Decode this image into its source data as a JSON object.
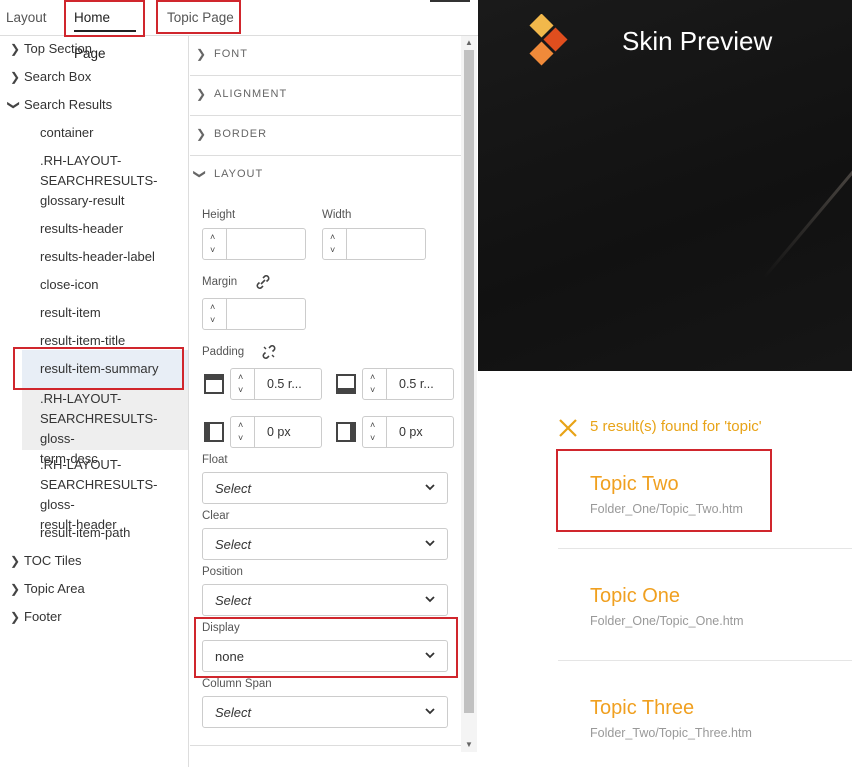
{
  "tabs": [
    "Layout",
    "Home Page",
    "Topic Page"
  ],
  "tree": {
    "sections_top": [
      "Top Section",
      "Search Box",
      "Search Results"
    ],
    "leaves": [
      "container",
      ".RH-LAYOUT-\nSEARCHRESULTS-\nglossary-result",
      "results-header",
      "results-header-label",
      "close-icon",
      "result-item",
      "result-item-title",
      "result-item-summary",
      ".RH-LAYOUT-\nSEARCHRESULTS-gloss-\nterm-desc",
      ".RH-LAYOUT-\nSEARCHRESULTS-gloss-\nresult-header",
      "result-item-path"
    ],
    "sections_bottom": [
      "TOC Tiles",
      "Topic Area",
      "Footer"
    ]
  },
  "props": {
    "accordions": [
      "FONT",
      "ALIGNMENT",
      "BORDER",
      "LAYOUT"
    ],
    "height_label": "Height",
    "width_label": "Width",
    "margin_label": "Margin",
    "padding_label": "Padding",
    "padding_top": "0.5 r...",
    "padding_bottom": "0.5 r...",
    "padding_left": "0 px",
    "padding_right": "0 px",
    "selects": [
      {
        "label": "Float",
        "value": "Select"
      },
      {
        "label": "Clear",
        "value": "Select"
      },
      {
        "label": "Position",
        "value": "Select"
      },
      {
        "label": "Display",
        "value": "none"
      },
      {
        "label": "Column Span",
        "value": "Select"
      }
    ]
  },
  "preview": {
    "title": "Skin Preview",
    "result_header": "5 result(s) found for 'topic'",
    "results": [
      {
        "title": "Topic Two",
        "path": "Folder_One/Topic_Two.htm"
      },
      {
        "title": "Topic One",
        "path": "Folder_One/Topic_One.htm"
      },
      {
        "title": "Topic Three",
        "path": "Folder_Two/Topic_Three.htm"
      }
    ]
  },
  "colors": {
    "accent": "#f0a020",
    "highlight": "#d0262d"
  }
}
